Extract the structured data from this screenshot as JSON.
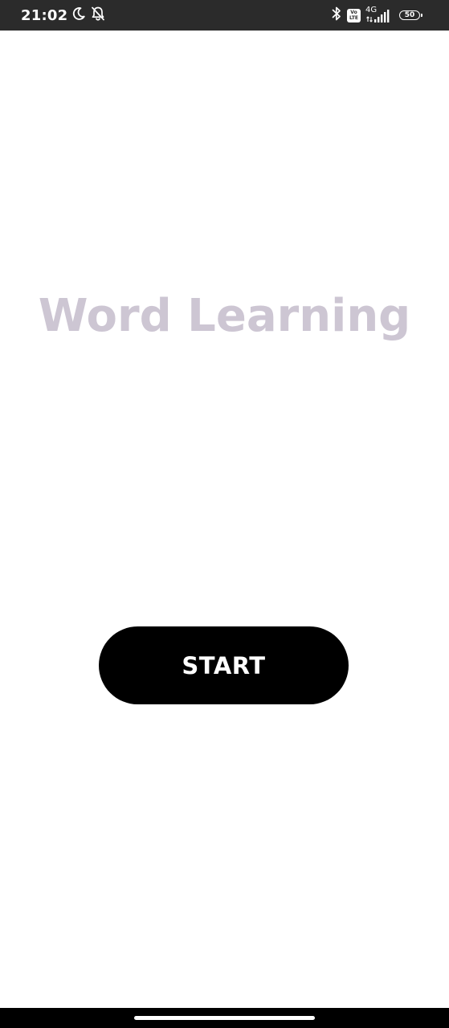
{
  "status_bar": {
    "time": "21:02",
    "network": "4G",
    "volte_line1": "Vo",
    "volte_line2": "LTE",
    "battery": "50",
    "icons": [
      "moon-icon",
      "bell-off-icon",
      "bluetooth-icon",
      "volte-icon",
      "signal-icon",
      "battery-icon"
    ]
  },
  "main": {
    "title": "Word Learning",
    "start_label": "START"
  },
  "colors": {
    "title": "#cdc6d3",
    "button_bg": "#000000",
    "button_text": "#ffffff",
    "status_bar_bg": "#2b2b2b"
  }
}
